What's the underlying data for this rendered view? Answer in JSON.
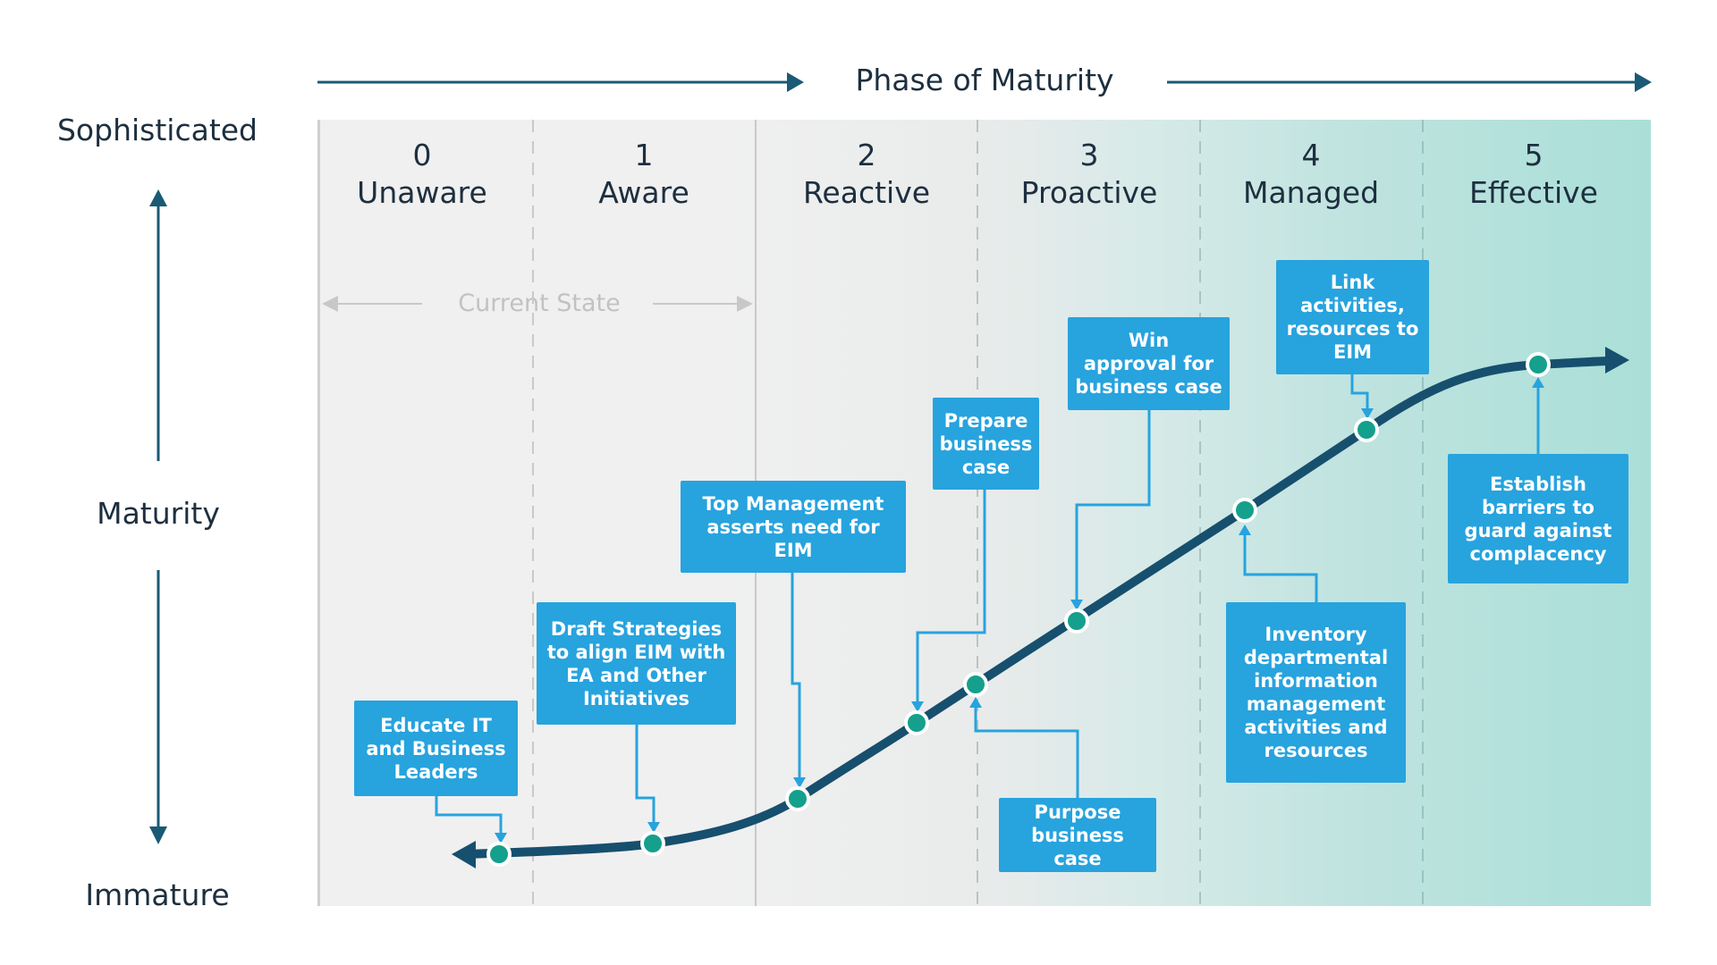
{
  "title": "Phase of Maturity",
  "y_axis": {
    "top_label": "Sophisticated",
    "middle_label": "Maturity",
    "bottom_label": "Immature"
  },
  "phases": [
    {
      "number": "0",
      "name": "Unaware"
    },
    {
      "number": "1",
      "name": "Aware"
    },
    {
      "number": "2",
      "name": "Reactive"
    },
    {
      "number": "3",
      "name": "Proactive"
    },
    {
      "number": "4",
      "name": "Managed"
    },
    {
      "number": "5",
      "name": "Effective"
    }
  ],
  "current_state_label": "Current State",
  "current_state_span": {
    "from_phase": 0,
    "to_phase": 1
  },
  "milestones": [
    {
      "id": "educate",
      "text": "Educate IT\nand Business\nLeaders",
      "phase": 0
    },
    {
      "id": "draft",
      "text": "Draft Strategies\nto align EIM with\nEA and Other\nInitiatives",
      "phase": 1
    },
    {
      "id": "top-mgmt",
      "text": "Top Management\nasserts need for EIM",
      "phase": 2
    },
    {
      "id": "prepare",
      "text": "Prepare\nbusiness\ncase",
      "phase": 2
    },
    {
      "id": "purpose",
      "text": "Purpose\nbusiness case",
      "phase": 3
    },
    {
      "id": "win",
      "text": "Win\napproval for\nbusiness case",
      "phase": 3
    },
    {
      "id": "inventory",
      "text": "Inventory\ndepartmental\ninformation\nmanagement\nactivities and\nresources",
      "phase": 4
    },
    {
      "id": "link",
      "text": "Link\nactivities,\nresources to\nEIM",
      "phase": 4
    },
    {
      "id": "establish",
      "text": "Establish\nbarriers to\nguard against\ncomplacency",
      "phase": 5
    }
  ],
  "colors": {
    "box": "#27a3de",
    "curve": "#174f6e",
    "point": "#14a08c",
    "axis": "#1a5a75",
    "text": "#1d2f3f",
    "current_state": "#c2c2c2"
  }
}
